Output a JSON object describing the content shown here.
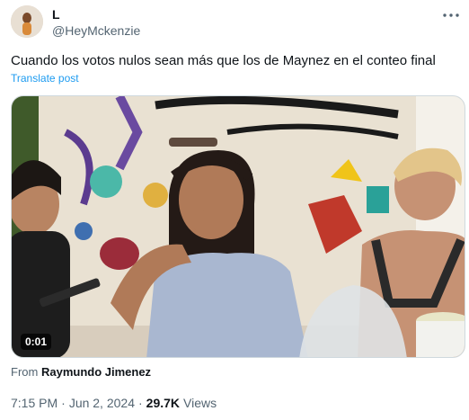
{
  "author": {
    "display_name": "L",
    "handle": "@HeyMckenzie"
  },
  "tweet": {
    "text": "Cuando los votos nulos sean más que los de Maynez en el conteo final",
    "translate_label": "Translate post"
  },
  "media": {
    "duration": "0:01",
    "attribution_prefix": "From",
    "attribution_name": "Raymundo Jimenez"
  },
  "meta": {
    "time": "7:15 PM",
    "separator": "·",
    "date": "Jun 2, 2024",
    "separator2": "·",
    "views_count": "29.7K",
    "views_label": "Views"
  },
  "icons": {
    "more": "more-horizontal-icon"
  },
  "colors": {
    "text_primary": "#0f1419",
    "text_secondary": "#536471",
    "link": "#1d9bf0",
    "border": "#cfd9de"
  }
}
